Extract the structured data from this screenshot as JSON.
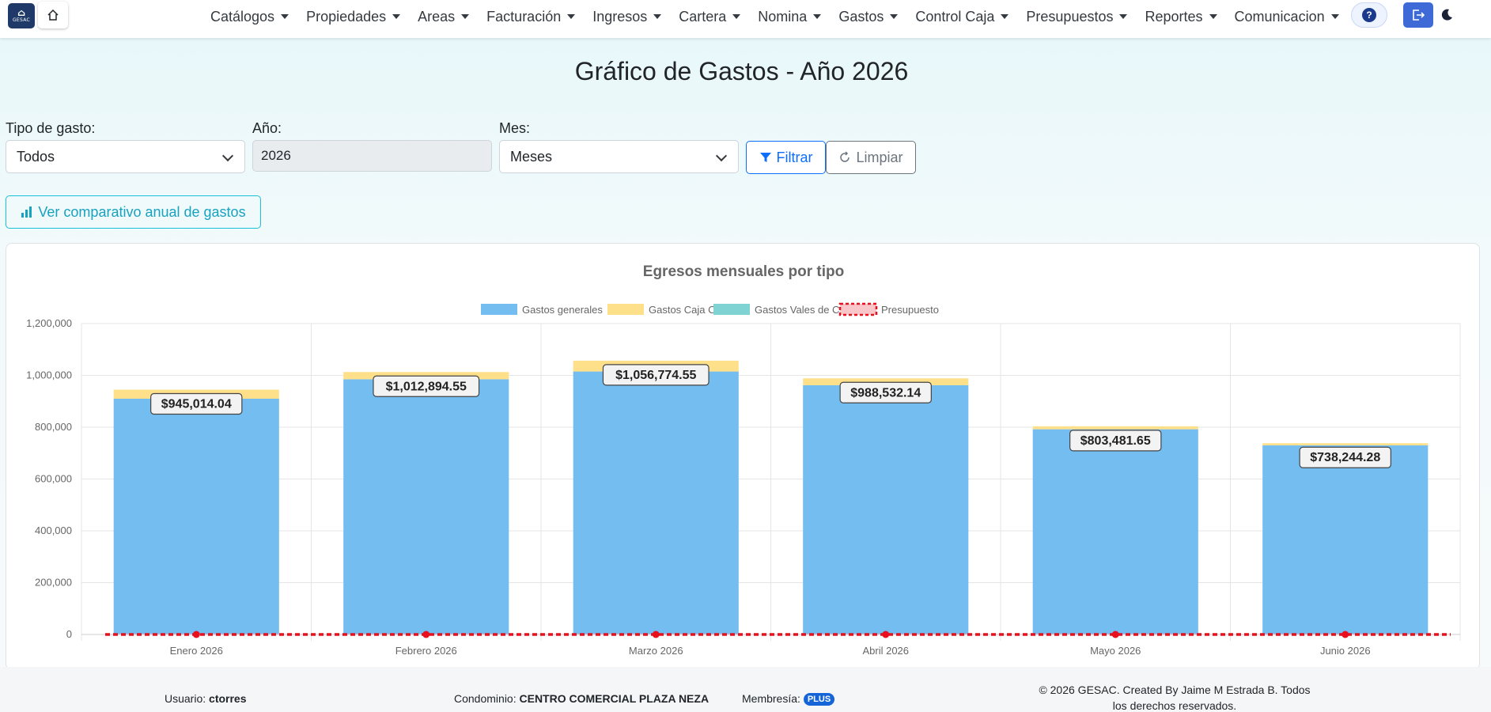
{
  "nav": {
    "logo_text": "GESAC",
    "menu": [
      "Catálogos",
      "Propiedades",
      "Areas",
      "Facturación",
      "Ingresos",
      "Cartera",
      "Nomina",
      "Gastos",
      "Control Caja",
      "Presupuestos",
      "Reportes",
      "Comunicacion"
    ],
    "help_label": "?"
  },
  "page": {
    "title": "Gráfico de Gastos - Año 2026"
  },
  "filters": {
    "tipo_label": "Tipo de gasto:",
    "tipo_value": "Todos",
    "anio_label": "Año:",
    "anio_value": "2026",
    "mes_label": "Mes:",
    "mes_value": "Meses",
    "filter_button": "Filtrar",
    "clear_button": "Limpiar",
    "compare_button": "Ver comparativo anual de gastos"
  },
  "colors": {
    "gastos_generales": "#74bdf0",
    "caja_chica": "#ffe08a",
    "vales_caja": "#7fd3d3",
    "presupuesto": "#e8101e",
    "accent": "#0d6efd"
  },
  "chart_data": {
    "type": "bar",
    "stacked": true,
    "title": "Egresos mensuales por tipo",
    "legend_position": "top",
    "categories": [
      "Enero 2026",
      "Febrero 2026",
      "Marzo 2026",
      "Abril 2026",
      "Mayo 2026",
      "Junio 2026"
    ],
    "series": [
      {
        "name": "Gastos generales",
        "type": "bar",
        "values": [
          910000,
          985000,
          1015000,
          962000,
          792000,
          730000
        ]
      },
      {
        "name": "Gastos Caja Chica",
        "type": "bar",
        "values": [
          35014.04,
          27894.55,
          41774.55,
          26532.14,
          11481.65,
          8244.28
        ]
      },
      {
        "name": "Gastos Vales de Caja",
        "type": "bar",
        "values": [
          0,
          0,
          0,
          0,
          0,
          0
        ]
      },
      {
        "name": "Presupuesto",
        "type": "line",
        "values": [
          0,
          0,
          0,
          0,
          0,
          0
        ]
      }
    ],
    "total_labels": [
      "$945,014.04",
      "$1,012,894.55",
      "$1,056,774.55",
      "$988,532.14",
      "$803,481.65",
      "$738,244.28"
    ],
    "ylim": [
      0,
      1200000
    ],
    "y_ticks": [
      "0",
      "200,000",
      "400,000",
      "600,000",
      "800,000",
      "1,000,000",
      "1,200,000"
    ],
    "grid": true
  },
  "footer": {
    "usuario_label": "Usuario:",
    "usuario_value": "ctorres",
    "condominio_label": "Condominio:",
    "condominio_value": "CENTRO COMERCIAL PLAZA NEZA",
    "membresia_label": "Membresía:",
    "membresia_value": "PLUS",
    "copyright_line1": "© 2026 GESAC. Created By Jaime M Estrada B. Todos",
    "copyright_line2": "los derechos reservados."
  }
}
